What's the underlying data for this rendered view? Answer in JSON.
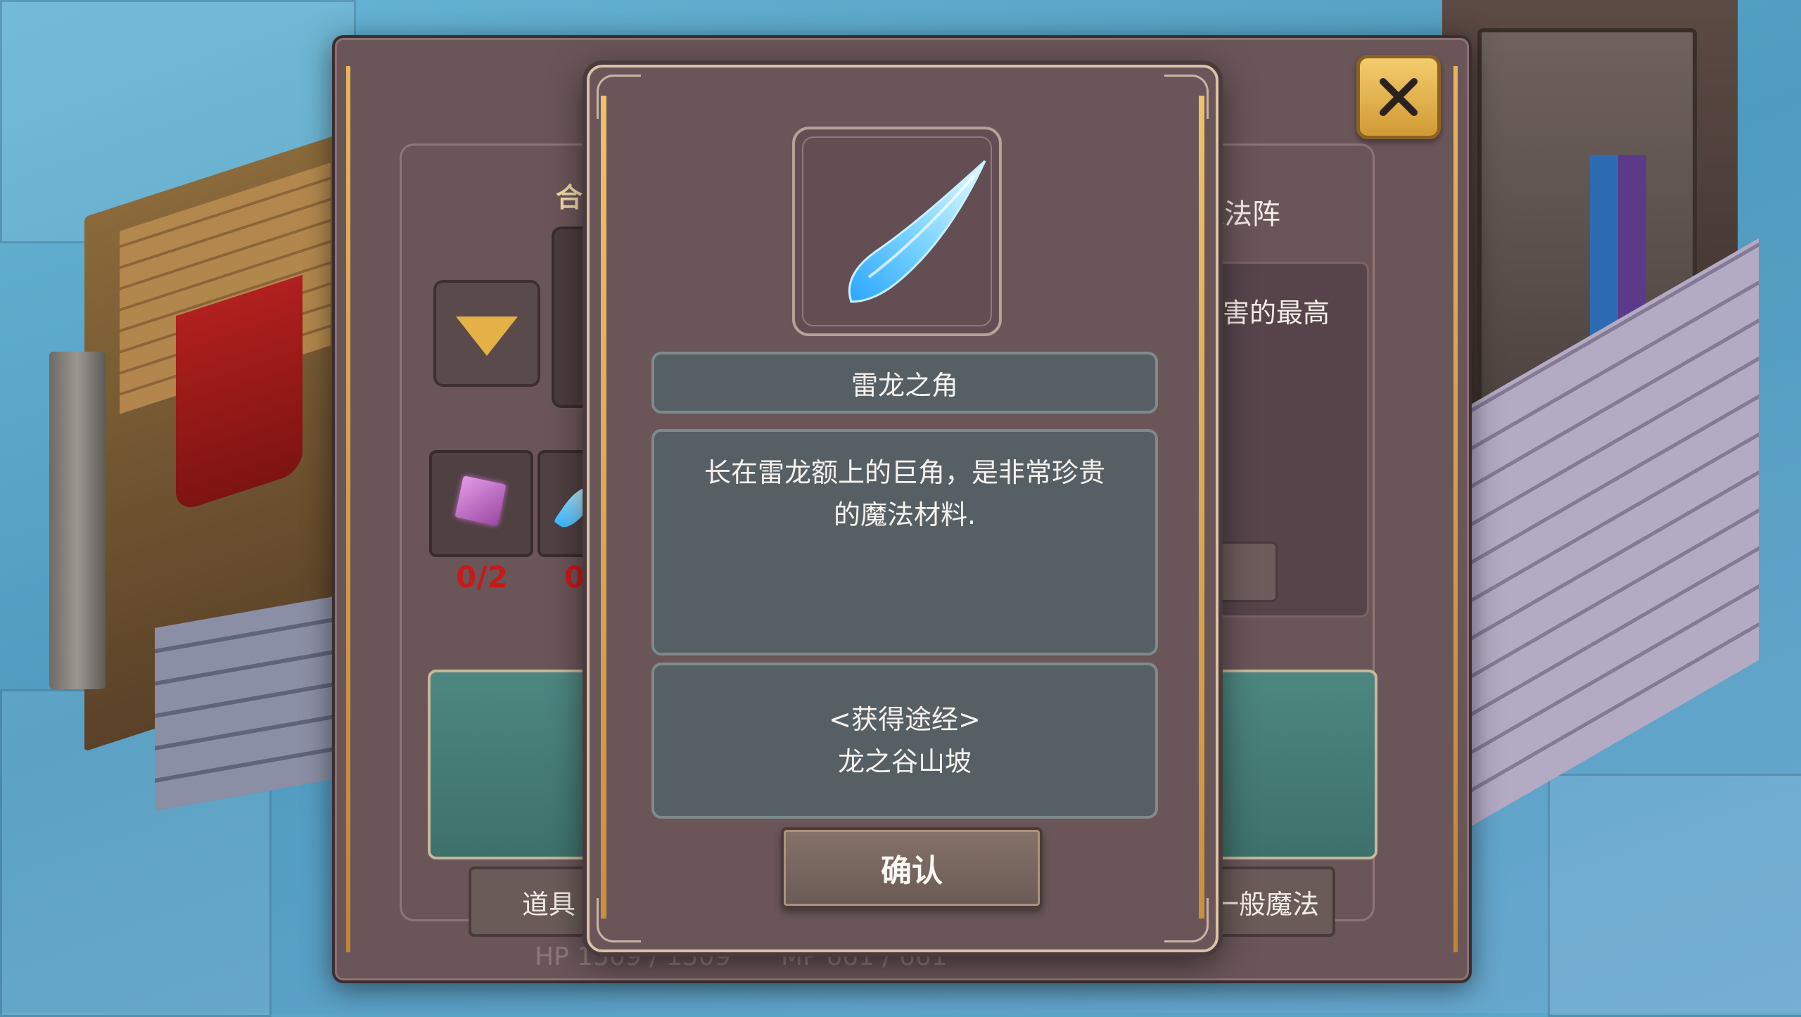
{
  "main_panel": {
    "left_title": "合",
    "right_title": "魔法阵",
    "right_description": "伤害的最高",
    "materials": [
      {
        "icon": "purple-gem-icon",
        "count": "0/2"
      },
      {
        "icon": "blue-horn-icon",
        "count": "0"
      }
    ],
    "tabs": [
      "道具",
      "一般魔法"
    ],
    "status": {
      "hp": "HP 1509 / 1509",
      "mp": "MP 661 / 661"
    }
  },
  "item_popup": {
    "icon": "thunder-dragon-horn-icon",
    "name": "雷龙之角",
    "description_lines": [
      "长在雷龙额上的巨角，是非常珍贵",
      "的魔法材料."
    ],
    "source_label": "<获得途经>",
    "source_value": "龙之谷山坡",
    "confirm_label": "确认"
  },
  "colors": {
    "panel": "#6a5559",
    "accent_gold": "#e4b146",
    "text_box": "#566064",
    "count_red": "#c51a1a"
  }
}
